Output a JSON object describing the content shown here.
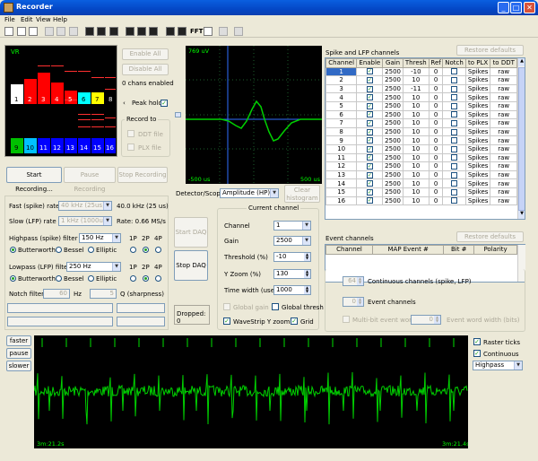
{
  "window": {
    "title": "Recorder"
  },
  "menu": [
    "File",
    "Edit",
    "View",
    "Help"
  ],
  "toolbar": {
    "fft": "FFT"
  },
  "vr": {
    "label": "VR",
    "channels": [
      "1",
      "2",
      "3",
      "4",
      "5",
      "6",
      "7",
      "8",
      "9",
      "10",
      "11",
      "12",
      "13",
      "14",
      "15",
      "16"
    ]
  },
  "controls": {
    "enable_all": "Enable All",
    "disable_all": "Disable All",
    "chans_enabled": "0 chans enabled",
    "peak_hold": "Peak hold",
    "record_to": "Record to",
    "ddt_file": "DDT file",
    "plx_file": "PLX file"
  },
  "recording": {
    "start": "Start Recording...",
    "pause": "Pause Recording",
    "stop": "Stop Recording"
  },
  "scope": {
    "top_label": "769 uV",
    "left_label": "-500 us",
    "right_label": "500 us",
    "detector_label": "Detector/Scope",
    "detector_value": "Amplitude (HP)",
    "clear_histogram": "Clear histogram"
  },
  "rates": {
    "fast_label": "Fast (spike) rate",
    "fast_select": "40 kHz (25us)",
    "fast_value": "40.0 kHz (25 us)",
    "slow_label": "Slow (LFP) rate",
    "slow_select": "1 kHz (1000us)",
    "slow_value": "Rate: 0.66 MS/s"
  },
  "filters": {
    "highpass_label": "Highpass (spike) filter",
    "highpass_value": "150 Hz",
    "lowpass_label": "Lowpass (LFP) filter",
    "lowpass_value": "250 Hz",
    "poles": [
      "1P",
      "2P",
      "4P"
    ],
    "types": [
      "Butterworth",
      "Bessel",
      "Elliptic"
    ],
    "notch_label": "Notch filter",
    "notch_value": "60",
    "notch_unit": "Hz",
    "q_value": "5",
    "q_label": "Q (sharpness)"
  },
  "daq": {
    "start": "Start DAQ",
    "stop": "Stop DAQ",
    "dropped": "Dropped: 0"
  },
  "current_channel": {
    "title": "Current channel",
    "channel_label": "Channel",
    "channel_value": "1",
    "gain_label": "Gain",
    "gain_value": "2500",
    "threshold_label": "Threshold (%)",
    "threshold_value": "-10",
    "yzoom_label": "Y Zoom (%)",
    "yzoom_value": "130",
    "timewidth_label": "Time width (usec)",
    "timewidth_value": "1000",
    "global_gain": "Global gain",
    "global_thresh": "Global thresh",
    "wavestrip": "WaveStrip Y zoom",
    "grid": "Grid"
  },
  "spike_lfp": {
    "title": "Spike and LFP channels",
    "restore": "Restore defaults",
    "headers": [
      "Channel",
      "Enable",
      "Gain",
      "Thresh",
      "Ref",
      "Notch",
      "to PLX",
      "to DDT"
    ],
    "rows": [
      [
        "1",
        "2500",
        "-10",
        "0",
        "Spikes",
        "raw"
      ],
      [
        "2",
        "2500",
        "10",
        "0",
        "Spikes",
        "raw"
      ],
      [
        "3",
        "2500",
        "-11",
        "0",
        "Spikes",
        "raw"
      ],
      [
        "4",
        "2500",
        "10",
        "0",
        "Spikes",
        "raw"
      ],
      [
        "5",
        "2500",
        "10",
        "0",
        "Spikes",
        "raw"
      ],
      [
        "6",
        "2500",
        "10",
        "0",
        "Spikes",
        "raw"
      ],
      [
        "7",
        "2500",
        "10",
        "0",
        "Spikes",
        "raw"
      ],
      [
        "8",
        "2500",
        "10",
        "0",
        "Spikes",
        "raw"
      ],
      [
        "9",
        "2500",
        "10",
        "0",
        "Spikes",
        "raw"
      ],
      [
        "10",
        "2500",
        "10",
        "0",
        "Spikes",
        "raw"
      ],
      [
        "11",
        "2500",
        "10",
        "0",
        "Spikes",
        "raw"
      ],
      [
        "12",
        "2500",
        "10",
        "0",
        "Spikes",
        "raw"
      ],
      [
        "13",
        "2500",
        "10",
        "0",
        "Spikes",
        "raw"
      ],
      [
        "14",
        "2500",
        "10",
        "0",
        "Spikes",
        "raw"
      ],
      [
        "15",
        "2500",
        "10",
        "0",
        "Spikes",
        "raw"
      ],
      [
        "16",
        "2500",
        "10",
        "0",
        "Spikes",
        "raw"
      ]
    ]
  },
  "events": {
    "title": "Event channels",
    "restore": "Restore defaults",
    "headers": [
      "Channel",
      "MAP Event #",
      "Bit #",
      "Polarity"
    ]
  },
  "continuous": {
    "channels_value": "64",
    "channels_label": "Continuous channels (spike, LFP)",
    "event_value": "0",
    "event_label": "Event channels",
    "multibit": "Multi-bit event word",
    "word_value": "0",
    "word_label": "Event word width (bits)"
  },
  "strip": {
    "faster": "faster",
    "pause": "pause",
    "slower": "slower",
    "left_time": "3m:21.2s",
    "right_time": "3m:21.4s",
    "raster": "Raster ticks",
    "continuous": "Continuous",
    "filter_value": "Highpass"
  }
}
